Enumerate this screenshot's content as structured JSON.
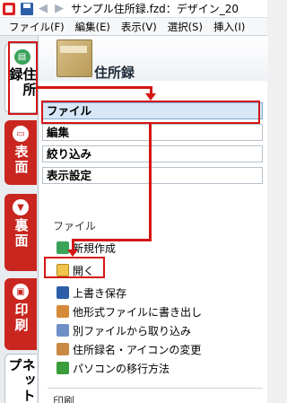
{
  "window": {
    "title": "サンプル住所録.fzd：デザイン_20",
    "nav_arrows": "◀ ▶"
  },
  "menubar": {
    "items": [
      "ファイル(F)",
      "編集(E)",
      "表示(V)",
      "選択(S)",
      "挿入(I)"
    ]
  },
  "side_tabs": {
    "address_book": "住所録",
    "front": "表面",
    "back": "裏面",
    "print": "印刷",
    "net": "ネットプ"
  },
  "panel": {
    "title": "住所録",
    "categories": [
      "ファイル",
      "編集",
      "絞り込み",
      "表示設定"
    ],
    "section_file": "ファイル",
    "commands": [
      "新規作成",
      "開く",
      "上書き保存",
      "他形式ファイルに書き出し",
      "別ファイルから取り込み",
      "住所録名・アイコンの変更",
      "パソコンの移行方法"
    ],
    "section_print": "印刷"
  },
  "colors": {
    "annotation_red": "#d41515",
    "tab_red": "#c9261f",
    "selected_blue": "#d7e7f7"
  }
}
